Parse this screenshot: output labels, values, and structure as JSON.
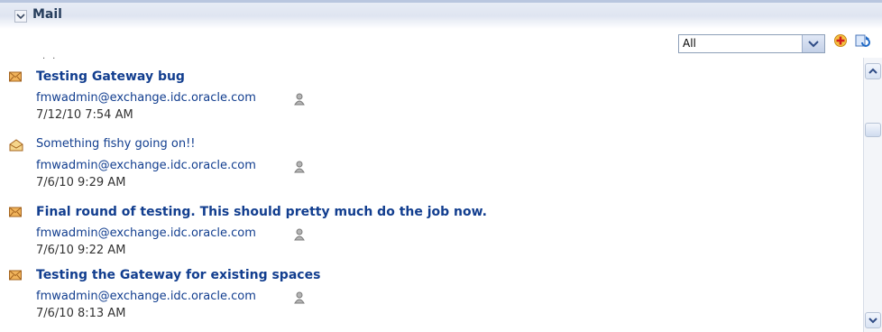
{
  "panel": {
    "title": "Mail",
    "collapse_icon": "chevron-down-icon"
  },
  "toolbar": {
    "filter_value": "All",
    "add_icon": "add-icon",
    "refresh_icon": "refresh-icon"
  },
  "messages": [
    {
      "subject": "Testing Gateway bug",
      "sender": "fmwadmin@exchange.idc.oracle.com",
      "date": "7/12/10 7:54 AM",
      "status": "unread",
      "icon": "envelope-closed-icon"
    },
    {
      "subject": "Something fishy going on!!",
      "sender": "fmwadmin@exchange.idc.oracle.com",
      "date": "7/6/10 9:29 AM",
      "status": "read",
      "icon": "envelope-open-icon"
    },
    {
      "subject": "Final round of testing. This should pretty much do the job now.",
      "sender": "fmwadmin@exchange.idc.oracle.com",
      "date": "7/6/10 9:22 AM",
      "status": "unread",
      "icon": "envelope-closed-icon"
    },
    {
      "subject": "Testing the Gateway for existing spaces",
      "sender": "fmwadmin@exchange.idc.oracle.com",
      "date": "7/6/10 8:13 AM",
      "status": "unread",
      "icon": "envelope-closed-icon"
    }
  ],
  "presence_icon": "presence-unknown-icon"
}
